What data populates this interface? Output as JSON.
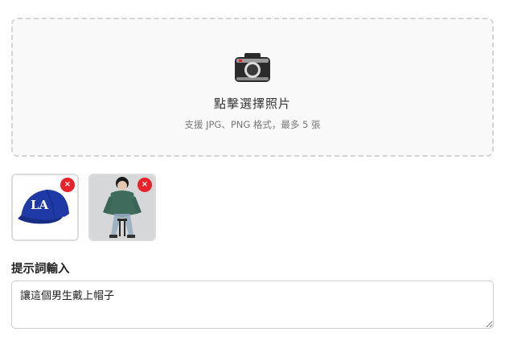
{
  "upload": {
    "title": "點擊選擇照片",
    "hint": "支援 JPG、PNG 格式，最多 5 張",
    "icon": "camera-icon"
  },
  "thumbnails": [
    {
      "name": "cap-image",
      "remove_label": "×"
    },
    {
      "name": "man-image",
      "remove_label": "×"
    }
  ],
  "prompt": {
    "label": "提示詞輸入",
    "value": "讓這個男生戴上帽子"
  },
  "colors": {
    "remove": "#e8222a",
    "cap_blue": "#1f3aa6"
  }
}
